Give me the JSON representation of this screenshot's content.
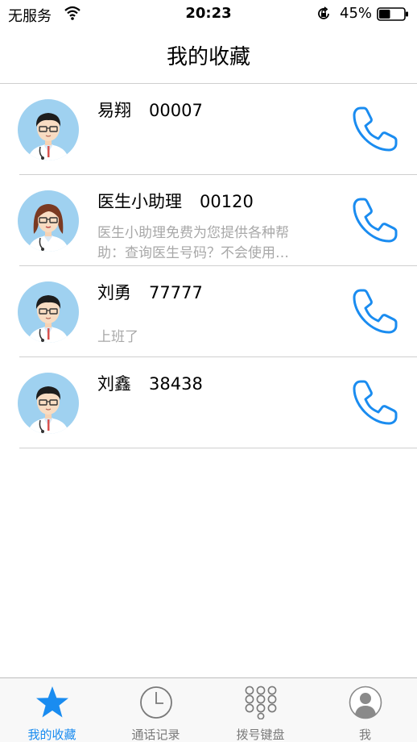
{
  "status_bar": {
    "carrier": "无服务",
    "time": "20:23",
    "battery": "45%",
    "battery_level": 0.45
  },
  "header": {
    "title": "我的收藏"
  },
  "contacts": [
    {
      "name": "易翔",
      "number": "00007",
      "desc": "",
      "avatar": "male-doctor"
    },
    {
      "name": "医生小助理",
      "number": "00120",
      "desc_line1": "医生小助理免费为您提供各种帮",
      "desc_line2": "助：查询医生号码？不会使用…",
      "avatar": "female-doctor"
    },
    {
      "name": "刘勇",
      "number": "77777",
      "desc": "上班了",
      "avatar": "male-doctor"
    },
    {
      "name": "刘鑫",
      "number": "38438",
      "desc": "",
      "avatar": "male-doctor"
    }
  ],
  "tabs": [
    {
      "label": "我的收藏",
      "icon": "star-icon",
      "active": true
    },
    {
      "label": "通话记录",
      "icon": "clock-icon",
      "active": false
    },
    {
      "label": "拨号键盘",
      "icon": "keypad-icon",
      "active": false
    },
    {
      "label": "我",
      "icon": "person-icon",
      "active": false
    }
  ],
  "colors": {
    "accent": "#1a8cf0",
    "secondary_text": "#a8a8a8",
    "divider": "#cfcfcf",
    "avatar_bg": "#9fd1f0"
  }
}
